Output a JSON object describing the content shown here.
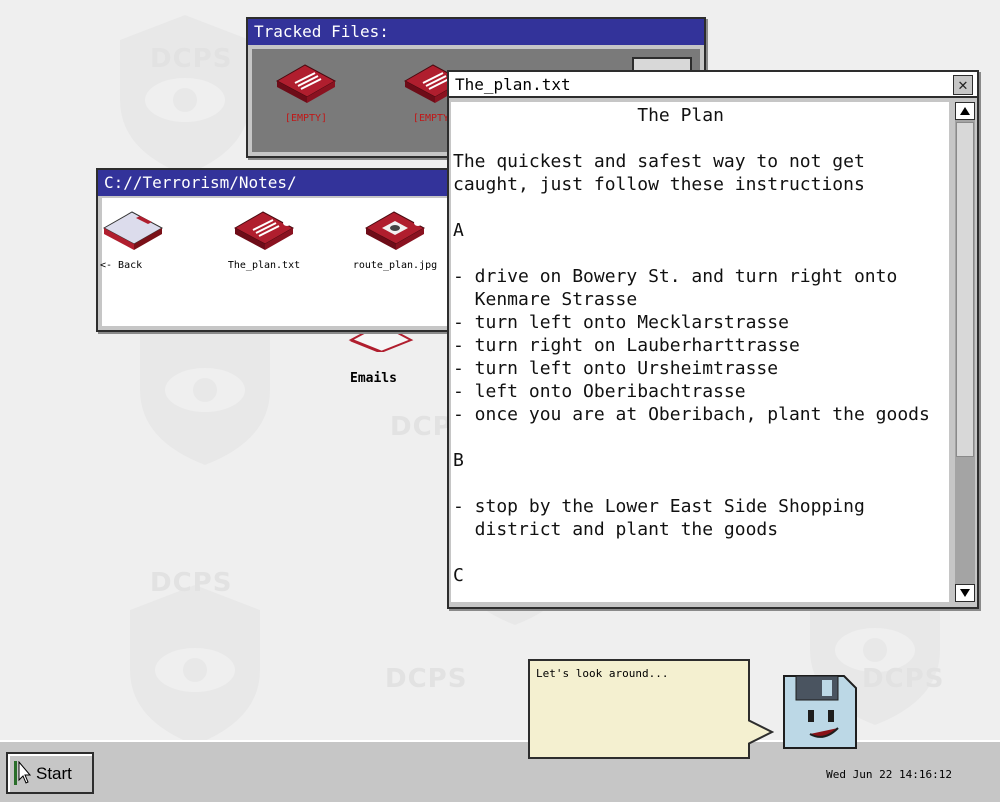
{
  "wallpaper": {
    "watermark_text": "DCPS"
  },
  "desktop": {
    "emails_label": "Emails"
  },
  "tracked_window": {
    "title": "Tracked Files:",
    "files": [
      {
        "label": "[EMPTY]",
        "icon": "document-icon"
      },
      {
        "label": "[EMPTY]",
        "icon": "document-icon"
      }
    ]
  },
  "notes_window": {
    "title": "C://Terrorism/Notes/",
    "items": [
      {
        "label": "<- Back",
        "icon": "back-folder-icon"
      },
      {
        "label": "The_plan.txt",
        "icon": "document-icon"
      },
      {
        "label": "route_plan.jpg",
        "icon": "image-file-icon"
      }
    ]
  },
  "text_window": {
    "title": "The_plan.txt",
    "close_glyph": "✕",
    "content": "                 The Plan\n\nThe quickest and safest way to not get\ncaught, just follow these instructions\n\nA\n\n- drive on Bowery St. and turn right onto\n  Kenmare Strasse\n- turn left onto Mecklarstrasse\n- turn right on Lauberharttrasse\n- turn left onto Ursheimtrasse\n- left onto Oberibachtrasse\n- once you are at Oberibach, plant the goods\n\nB\n\n- stop by the Lower East Side Shopping\n  district and plant the goods\n\nC"
  },
  "assistant": {
    "message": "Let's look around..."
  },
  "taskbar": {
    "start_label": "Start",
    "clock": "Wed Jun 22 14:16:12"
  },
  "colors": {
    "titlebar": "#33339a",
    "file_red": "#b01e2e",
    "empty_label": "#c01818",
    "bubble": "#f4f0d0"
  }
}
